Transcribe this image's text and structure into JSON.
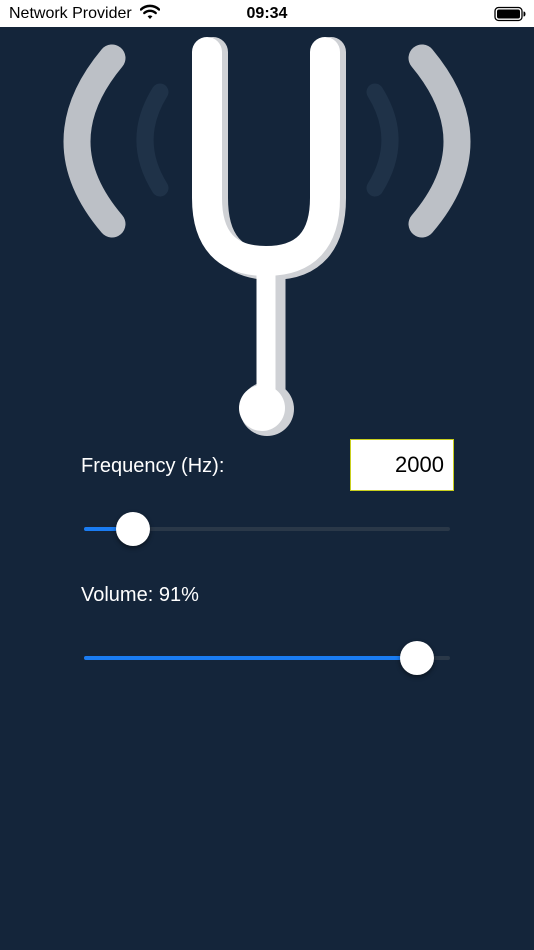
{
  "status_bar": {
    "carrier": "Network Provider",
    "time": "09:34",
    "wifi_icon": "wifi-icon",
    "battery_icon": "battery-icon"
  },
  "hero": {
    "icon": "tuning-fork-icon"
  },
  "frequency": {
    "label": "Frequency (Hz):",
    "value": "2000",
    "slider_fraction": 0.135
  },
  "volume": {
    "label": "Volume: 91%",
    "percent": 91
  },
  "colors": {
    "background": "#14253a",
    "accent": "#1a7cf2",
    "input_border": "#c9cf1e"
  }
}
